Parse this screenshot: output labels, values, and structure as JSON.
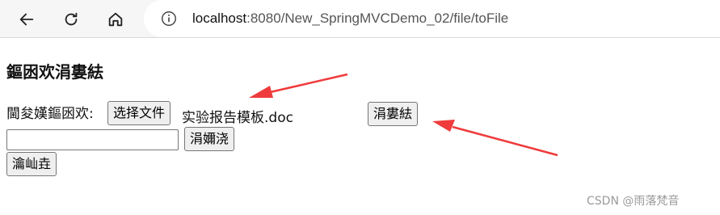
{
  "browser": {
    "url_host": "localhost",
    "url_rest": ":8080/New_SpringMVCDemo_02/file/toFile"
  },
  "page": {
    "title": "鏂囦欢涓婁紶",
    "file_label": "閫夋嫨鏂囦欢:",
    "choose_file_button": "选择文件",
    "selected_file_name": "实验报告模板.doc",
    "upload_button": "涓婁紶",
    "text_input_value": "",
    "submit_button": "涓嬭浇",
    "bottom_button": "瀹屾垚"
  },
  "watermark": "CSDN @雨落梵音",
  "annotations": {
    "arrow_color": "#ef3b3b"
  }
}
